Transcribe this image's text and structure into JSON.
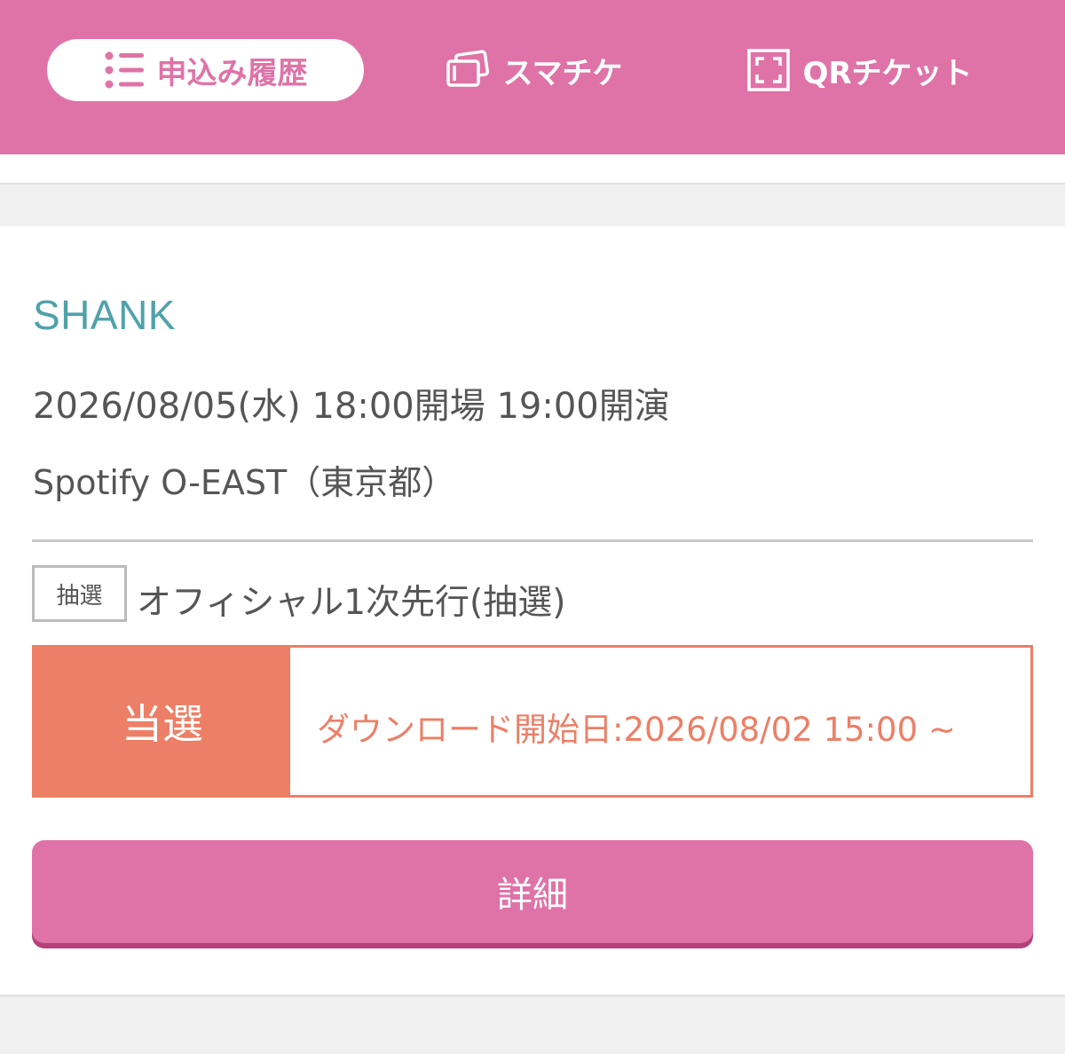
{
  "nav": {
    "tabs": [
      {
        "label": "申込み履歴",
        "icon": "list-icon",
        "active": true
      },
      {
        "label": "スマチケ",
        "icon": "ticket-icon",
        "active": false
      },
      {
        "label": "QRチケット",
        "icon": "qr-scan-icon",
        "active": false
      }
    ]
  },
  "colors": {
    "brand_pink": "#df73a7",
    "artist_teal": "#4fa2aa",
    "result_coral": "#ec7f66"
  },
  "ticket": {
    "artist": "SHANK",
    "datetime": "2026/08/05(水) 18:00開場 19:00開演",
    "venue": "Spotify O-EAST（東京都）",
    "badge": "抽選",
    "sale_name": "オフィシャル1次先行(抽選)",
    "result": "当選",
    "download": "ダウンロード開始日:2026/08/02 15:00 ~",
    "detail_button": "詳細"
  }
}
